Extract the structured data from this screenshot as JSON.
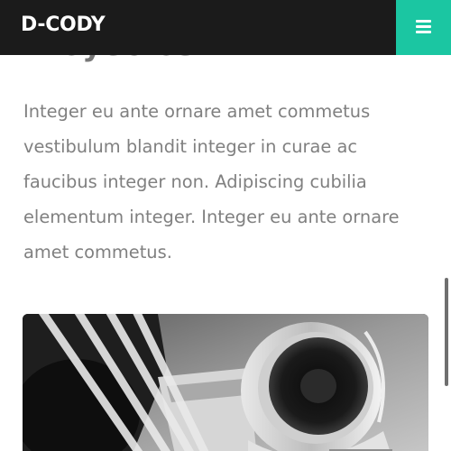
{
  "header": {
    "brand": "D-CODY",
    "menu_icon": "hamburger-menu-icon",
    "accent_color": "#1bc6a2",
    "background_color": "#1b1b1b"
  },
  "main": {
    "section_title": "Proyectos",
    "intro_text": "Integer eu ante ornare amet commetus vestibulum blandit integer in curae ac faucibus integer non. Adipiscing cubilia elementum integer. Integer eu ante ornare amet commetus.",
    "image": {
      "subject": "jet-engine-photo",
      "style": "black-and-white"
    }
  }
}
